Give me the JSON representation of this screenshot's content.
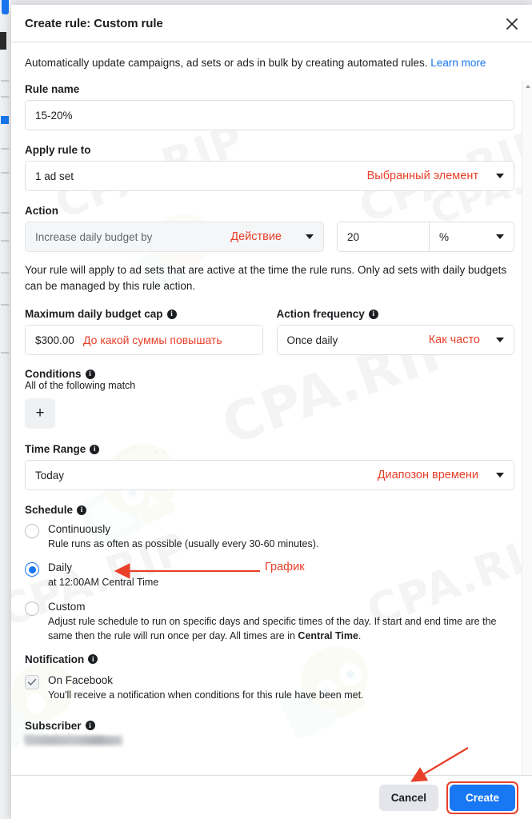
{
  "modal": {
    "title": "Create rule: Custom rule",
    "close_icon": "close-icon",
    "intro_text": "Automatically update campaigns, ad sets or ads in bulk by creating automated rules.",
    "learn_more": "Learn more"
  },
  "rule_name": {
    "label": "Rule name",
    "value": "15-20%"
  },
  "apply_rule_to": {
    "label": "Apply rule to",
    "value": "1 ad set",
    "annotation": "Выбранный элемент"
  },
  "action": {
    "label": "Action",
    "select_value": "Increase daily budget by",
    "annotation": "Действие",
    "amount": "20",
    "unit": "%",
    "helper_text": "Your rule will apply to ad sets that are active at the time the rule runs. Only ad sets with daily budgets can be managed by this rule action."
  },
  "budget_cap": {
    "label": "Maximum daily budget cap",
    "info_icon": "info-icon",
    "value": "$300.00",
    "annotation": "До какой суммы повышать"
  },
  "action_frequency": {
    "label": "Action frequency",
    "info_icon": "info-icon",
    "value": "Once daily",
    "annotation": "Как часто"
  },
  "conditions": {
    "label": "Conditions",
    "info_icon": "info-icon",
    "sub_note": "All of the following match",
    "add_button": "+"
  },
  "time_range": {
    "label": "Time Range",
    "info_icon": "info-icon",
    "value": "Today",
    "annotation": "Диапозон времени"
  },
  "schedule": {
    "label": "Schedule",
    "info_icon": "info-icon",
    "annotation": "График",
    "options": [
      {
        "title": "Continuously",
        "desc": "Rule runs as often as possible (usually every 30-60 minutes).",
        "selected": false
      },
      {
        "title": "Daily",
        "desc": "at 12:00AM Central Time",
        "selected": true
      },
      {
        "title": "Custom",
        "desc_part1": "Adjust rule schedule to run on specific days and specific times of the day. If start and end time are the same then the rule will run once per day. All times are in ",
        "desc_bold": "Central Time",
        "desc_part2": ".",
        "selected": false
      }
    ]
  },
  "notification": {
    "label": "Notification",
    "info_icon": "info-icon",
    "checkbox_label": "On Facebook",
    "checkbox_checked": true,
    "check_icon": "check-icon",
    "desc": "You'll receive a notification when conditions for this rule have been met."
  },
  "subscriber": {
    "label": "Subscriber",
    "info_icon": "info-icon",
    "value_redacted": "Machulin Zaval-kin"
  },
  "footer": {
    "cancel_label": "Cancel",
    "create_label": "Create"
  },
  "watermark": {
    "text": "CPA.RIP",
    "skull_icon": "skull-laptop-watermark-icon"
  },
  "colors": {
    "accent_blue": "#1877f2",
    "annotation_red": "#e8402a",
    "text_primary": "#1c1e21",
    "border": "#dddfe2"
  }
}
